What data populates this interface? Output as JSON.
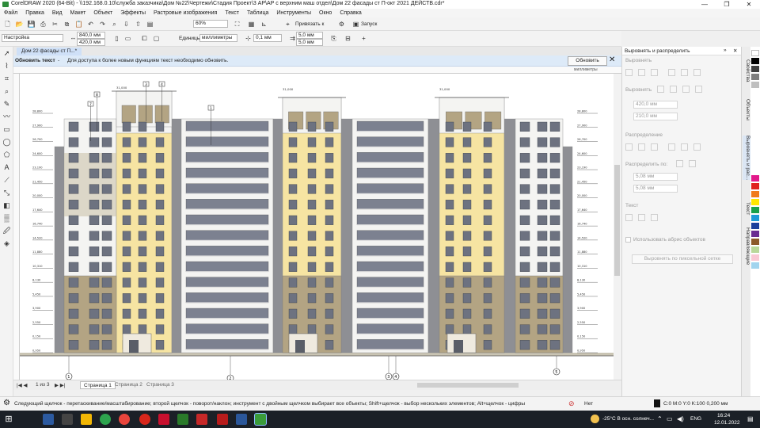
{
  "window": {
    "title": "CorelDRAW 2020 (64-Bit) - \\\\192.168.0.10\\служба заказчика\\Дом №22\\Чертежи\\Стадия Проект\\3 АР\\АР с верхним маш отдел\\Дом 22 фасады ст П-окт 2021 ДЕЙСТВ.cdr*",
    "minimize": "—",
    "maximize": "❐",
    "close": "✕"
  },
  "menu": [
    "Файл",
    "Правка",
    "Вид",
    "Макет",
    "Объект",
    "Эффекты",
    "Растровые изображения",
    "Текст",
    "Таблица",
    "Инструменты",
    "Окно",
    "Справка"
  ],
  "toolbar1": {
    "zoom": "60%",
    "snap_label": "Привязать к",
    "launch_label": "Запуск"
  },
  "toolbar2": {
    "preset": "Настройка",
    "width": "840,0 мм",
    "height": "420,0 мм",
    "units_label": "Единицы:",
    "units": "миллиметры",
    "nudge": "0,1 мм",
    "dup_x": "5,0 мм",
    "dup_y": "5,0 мм"
  },
  "doc_tab": "Дом 22 фасады ст П...*",
  "infobar": {
    "title": "Обновить текст",
    "dash": "-",
    "message": "Для доступа к более новым функциям текст необходимо обновить.",
    "button": "Обновить"
  },
  "ruler_unit": "миллиметры",
  "drawing": {
    "top_marks": [
      "3",
      "4",
      "7",
      "8",
      "1"
    ],
    "axis_labels": [
      "1",
      "2",
      "3",
      "4",
      "5"
    ],
    "top_levels": [
      "31,000",
      "31,000",
      "31,000"
    ],
    "levels": [
      "28,800",
      "27,900",
      "26,700",
      "24,600",
      "23,190",
      "21,450",
      "20,000",
      "17,640",
      "16,740",
      "14,520",
      "11,880",
      "10,310",
      "8,130",
      "5,450",
      "3,900",
      "2,550",
      "0,150",
      "0,950"
    ]
  },
  "pages": {
    "counter": "1 из 3",
    "tabs": [
      "Страница 1",
      "Страница 2",
      "Страница 3"
    ]
  },
  "status": {
    "hint": "Следующий щелчок - перетаскивание/масштабирование; второй щелчок - поворот/наклон; инструмент с двойным щелчком выбирает все объекты; Shift+щелчок - выбор нескольких элементов; Alt+щелчок - цифры",
    "fill": "Нет",
    "outline": "C:0 M:0 Y:0 K:100  0,200 мм"
  },
  "docker": {
    "title": "Выровнять и распределить",
    "align": "Выровнять",
    "align_to": "Выровнять",
    "w": "420,0 мм",
    "h": "210,0 мм",
    "distribute": "Распределение",
    "distribute_to": "Распределить по:",
    "sx": "5,08 мм",
    "sy": "5,08 мм",
    "text": "Текст",
    "outline_check": "Использовать абрис объектов",
    "pixel_btn": "Выровнять по пиксельной сетке",
    "tabs": [
      "Свойства",
      "Объекты",
      "Выровнять и рас...",
      "Текст",
      "Направляющие"
    ]
  },
  "taskbar": {
    "weather": "-25°C  В осн. солнеч...",
    "lang": "ENG",
    "time": "16:24",
    "date": "12.01.2022"
  },
  "colors": {
    "facade_yellow": "#f6e4a2",
    "facade_dark": "#b3a483",
    "facade_light": "#f4f4f2",
    "facade_grey": "#8e8f94",
    "window": "#6d7280",
    "accent_blue": "#1a6ecb"
  }
}
